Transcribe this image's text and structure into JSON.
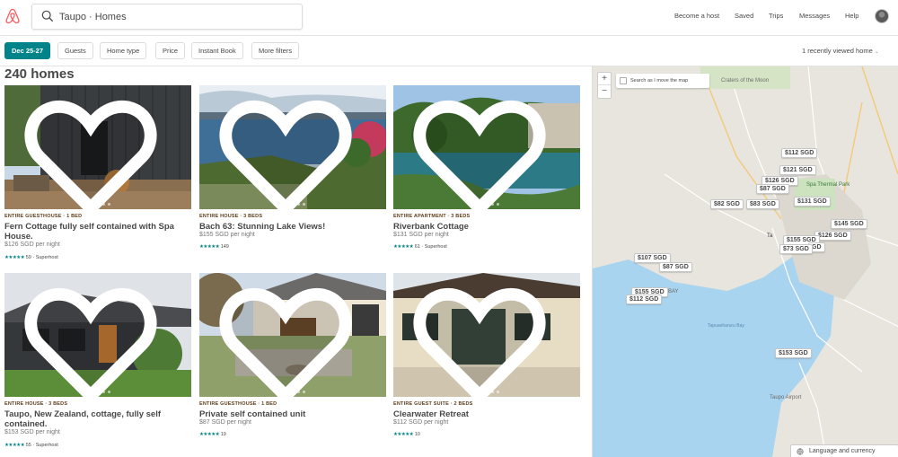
{
  "header": {
    "search_value": "Taupo · Homes",
    "nav": [
      "Become a host",
      "Saved",
      "Trips",
      "Messages",
      "Help"
    ]
  },
  "filters": {
    "dates": "Dec 25-27",
    "buttons": [
      "Guests",
      "Home type",
      "Price",
      "Instant Book",
      "More filters"
    ],
    "recently_viewed": "1 recently viewed home"
  },
  "results": {
    "count": "240 homes",
    "listings": [
      {
        "type": "ENTIRE GUESTHOUSE · 1 BED",
        "title": "Fern Cottage fully self contained with Spa House.",
        "price": "$126 SGD",
        "per": "per night",
        "stars": "★★★★★",
        "reviews": "59",
        "badge": " · Superhost"
      },
      {
        "type": "ENTIRE HOUSE · 3 BEDS",
        "title": "Bach 63: Stunning Lake Views!",
        "price": "$155 SGD",
        "per": "per night",
        "stars": "★★★★★",
        "reviews": "149",
        "badge": ""
      },
      {
        "type": "ENTIRE APARTMENT · 3 BEDS",
        "title": "Riverbank Cottage",
        "price": "$131 SGD",
        "per": "per night",
        "stars": "★★★★★",
        "reviews": "61",
        "badge": " · Superhost"
      },
      {
        "type": "ENTIRE HOUSE · 3 BEDS",
        "title": "Taupo, New Zealand, cottage, fully self contained.",
        "price": "$153 SGD",
        "per": "per night",
        "stars": "★★★★★",
        "reviews": "55",
        "badge": " · Superhost"
      },
      {
        "type": "ENTIRE GUESTHOUSE · 1 BED",
        "title": "Private self contained unit",
        "price": "$87 SGD",
        "per": "per night",
        "stars": "★★★★★",
        "reviews": "19",
        "badge": ""
      },
      {
        "type": "ENTIRE GUEST SUITE · 2 BEDS",
        "title": "Clearwater Retreat",
        "price": "$112 SGD",
        "per": "per night",
        "stars": "★★★★★",
        "reviews": "10",
        "badge": ""
      }
    ]
  },
  "map": {
    "search_toggle": "Search as I move the map",
    "zoom_in": "+",
    "zoom_out": "−",
    "language": "Language and currency",
    "labels": [
      "Craters of the Moon",
      "Spa Thermal Park",
      "Taupo Airport",
      "Tapuaeharuru Bay",
      "Ta",
      "BAY"
    ],
    "pins": [
      "$112 SGD",
      "$121 SGD",
      "$126 SGD",
      "$87 SGD",
      "$82 SGD",
      "$83 SGD",
      "$131 SGD",
      "$145 SGD",
      "$126 SGD",
      "$155 SGD",
      "GD",
      "$73 SGD",
      "$107 SGD",
      "$87 SGD",
      "$155 SGD",
      "$112 SGD",
      "$153 SGD"
    ]
  },
  "colors": {
    "accent": "#008489",
    "brand": "#FF5A5F",
    "type_label": "#5e3d1a"
  }
}
